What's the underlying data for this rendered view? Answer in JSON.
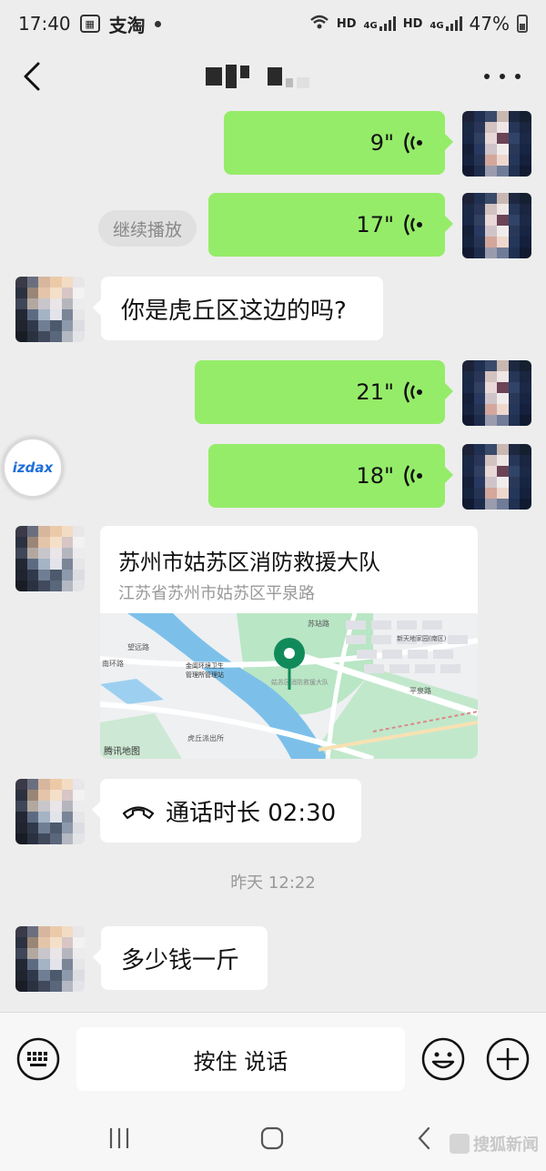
{
  "status_bar": {
    "time": "17:40",
    "app_label": "支淘",
    "network_1": "HD",
    "network_2": "HD",
    "signal_label_1": "4G",
    "signal_label_2": "4G",
    "battery_percent": "47%"
  },
  "header": {
    "back_icon": "chevron-left-icon",
    "more_icon": "more-dots-icon"
  },
  "messages": {
    "voice_1": {
      "duration": "9\""
    },
    "voice_2": {
      "duration": "17\""
    },
    "continue_play": "继续播放",
    "text_1": "你是虎丘区这边的吗?",
    "voice_3": {
      "duration": "21\""
    },
    "voice_4": {
      "duration": "18\""
    },
    "floating_badge": "izdax",
    "location": {
      "title": "苏州市姑苏区消防救援大队",
      "address": "江苏省苏州市姑苏区平泉路",
      "map_watermark": "腾讯地图",
      "map_labels": {
        "east_road": "苏站路",
        "north": "望远路",
        "west_road": "南环路",
        "center_a": "金阊环境卫生",
        "center_b": "管理所管理站",
        "south": "虎丘派出所",
        "ping_quan": "平泉路",
        "district": "新天地家园(南区)",
        "pin_label": "姑苏区消防救援大队"
      }
    },
    "call": {
      "label": "通话时长 02:30"
    },
    "time_divider": "昨天 12:22",
    "text_2": "多少钱一斤"
  },
  "input_bar": {
    "keyboard_icon": "keyboard-icon",
    "hold_to_talk": "按住 说话",
    "emoji_icon": "emoji-icon",
    "plus_icon": "plus-icon"
  },
  "nav_bar": {
    "watermark": "搜狐新闻"
  }
}
